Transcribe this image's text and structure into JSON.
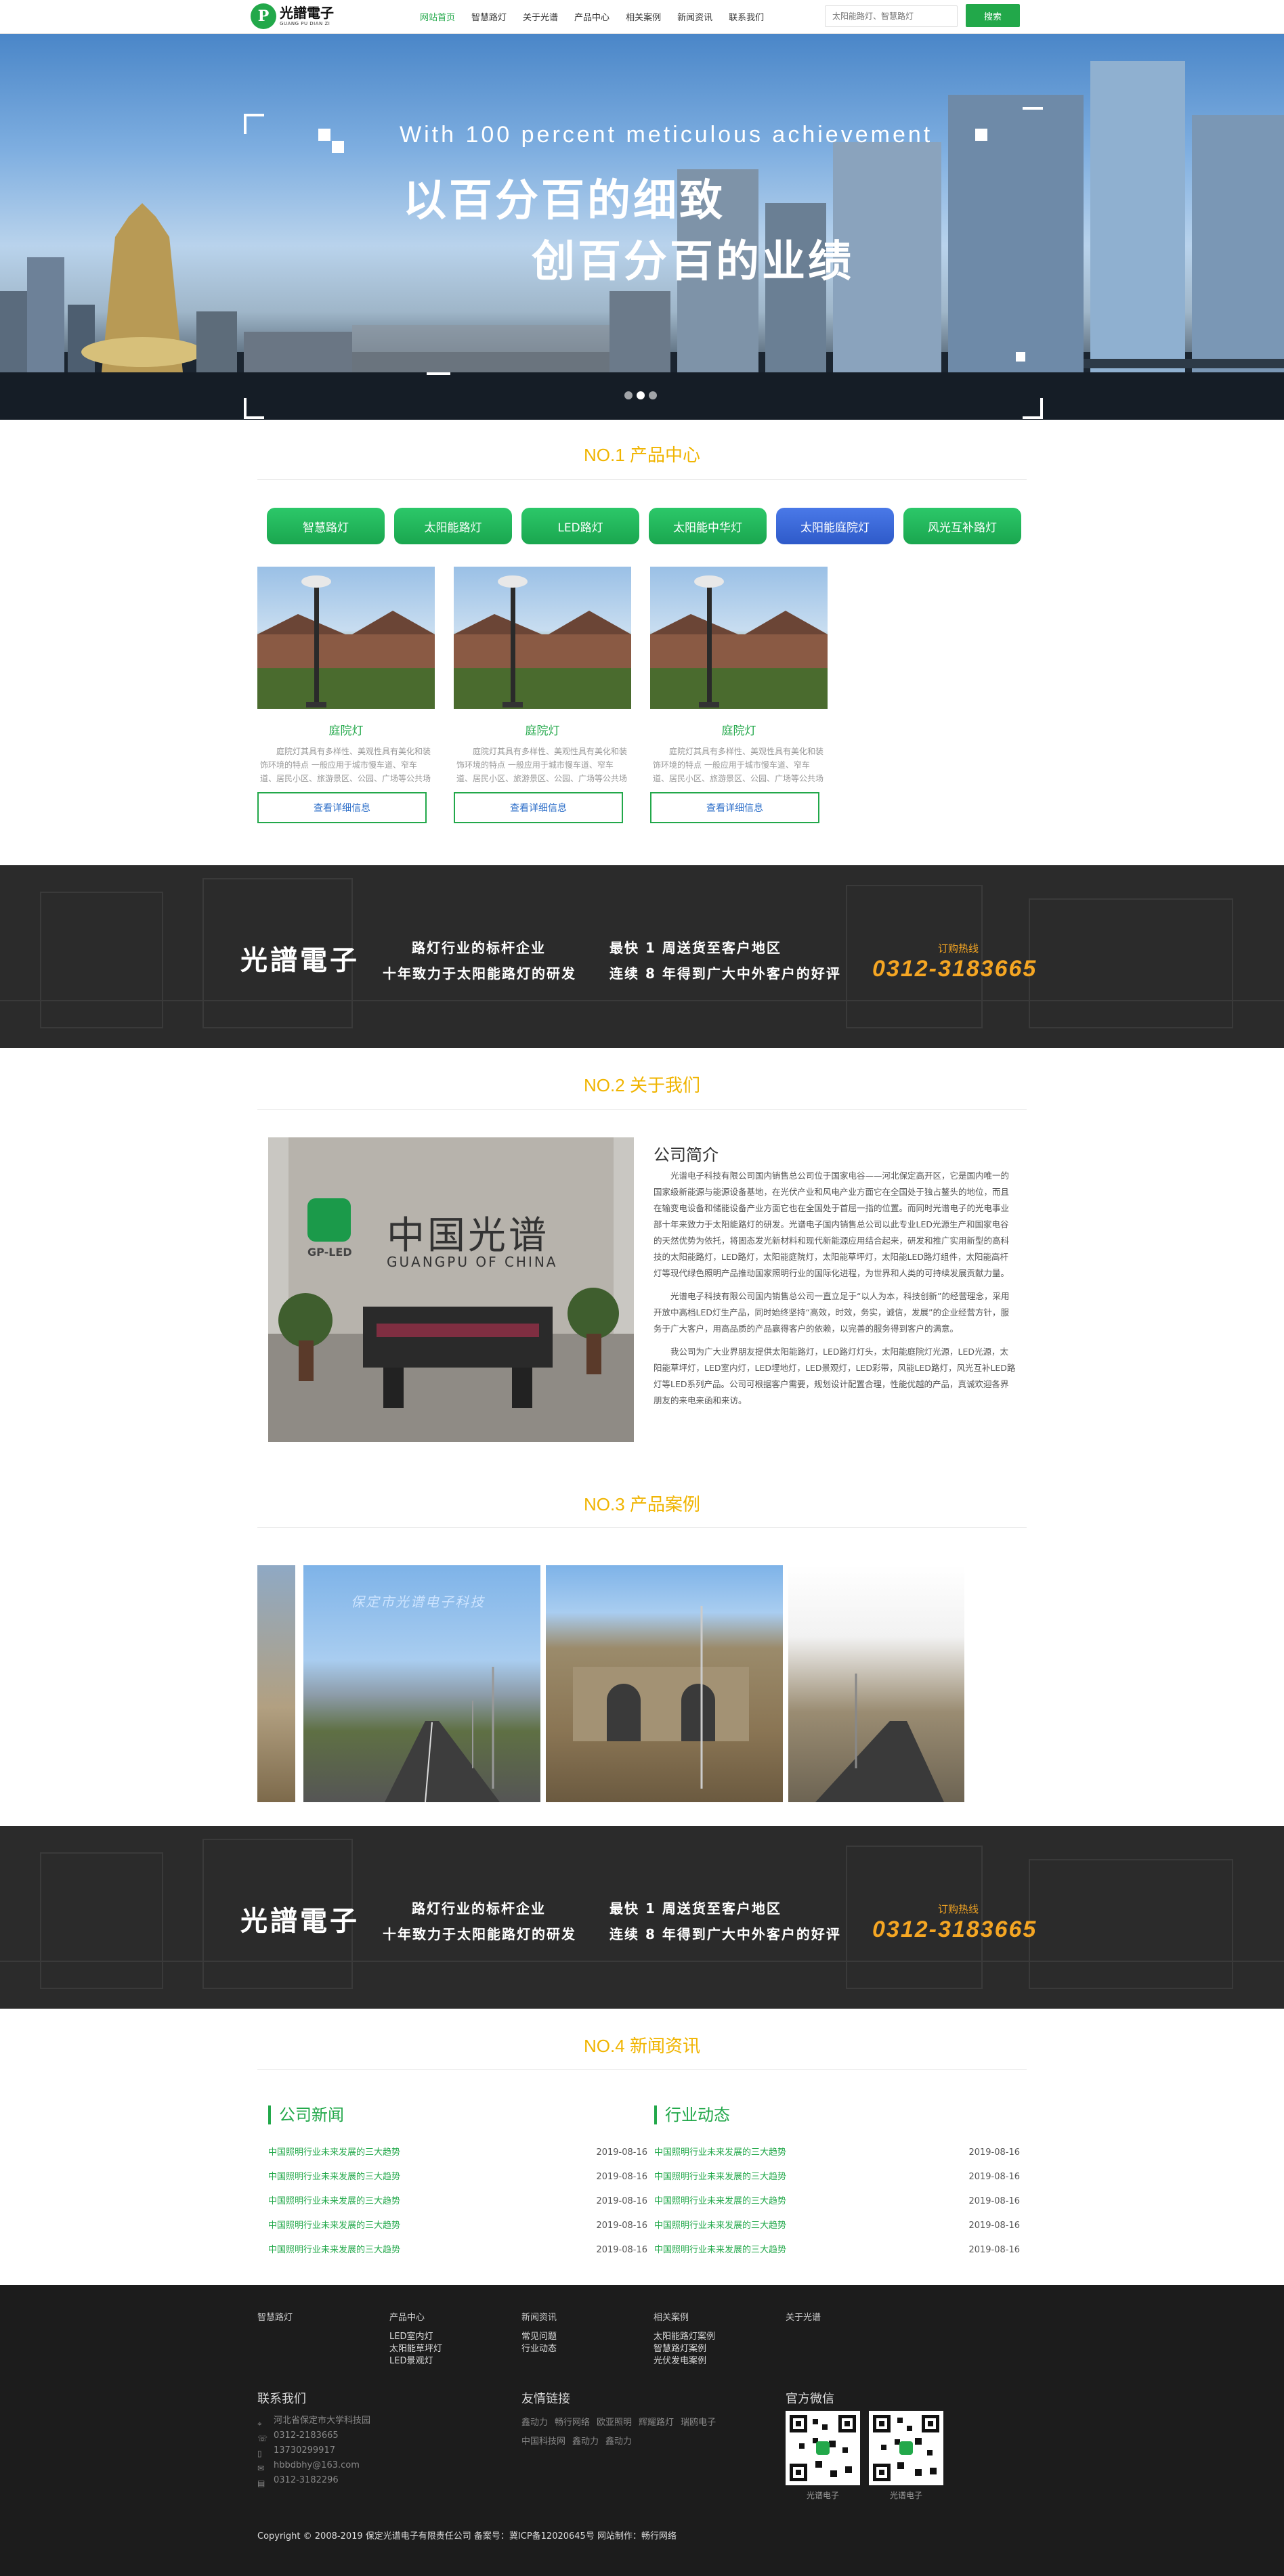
{
  "header": {
    "logo_cn": "光譜電子",
    "logo_en": "GUANG PU DIAN ZI",
    "nav": [
      "网站首页",
      "智慧路灯",
      "关于光谱",
      "产品中心",
      "相关案例",
      "新闻资讯",
      "联系我们"
    ],
    "search_placeholder": "太阳能路灯、智慧路灯",
    "search_button": "搜索"
  },
  "banner": {
    "en": "With 100 percent meticulous achievement",
    "cn_line1": "以百分百的细致",
    "cn_line2": "创百分百的业绩",
    "slides": 3,
    "active_slide": 1
  },
  "products": {
    "title": "NO.1 产品中心",
    "tabs": [
      "智慧路灯",
      "太阳能路灯",
      "LED路灯",
      "太阳能中华灯",
      "太阳能庭院灯",
      "风光互补路灯"
    ],
    "active_tab": 4,
    "items": [
      {
        "name": "庭院灯",
        "desc": "庭院灯其具有多样性、美观性具有美化和装饰环境的特点 一般应用于城市慢车道、窄车道、居民小区、旅游景区、公园、广场等公共场所的室外照明",
        "button": "查看详细信息"
      },
      {
        "name": "庭院灯",
        "desc": "庭院灯其具有多样性、美观性具有美化和装饰环境的特点 一般应用于城市慢车道、窄车道、居民小区、旅游景区、公园、广场等公共场所的室外照明",
        "button": "查看详细信息"
      },
      {
        "name": "庭院灯",
        "desc": "庭院灯其具有多样性、美观性具有美化和装饰环境的特点 一般应用于城市慢车道、窄车道、居民小区、旅游景区、公园、广场等公共场所的室外照明",
        "button": "查看详细信息"
      }
    ]
  },
  "band": {
    "logo": "光譜電子",
    "l1": "路灯行业的标杆企业",
    "l2": "十年致力于太阳能路灯的研发",
    "r1": "最快 1 周送货至客户地区",
    "r2": "连续 8 年得到广大中外客户的好评",
    "hotline_label": "订购热线",
    "phone": "0312-3183665"
  },
  "about": {
    "title": "NO.2 关于我们",
    "sub": "公司简介",
    "wall_cn": "中国光谱",
    "wall_en": "GUANGPU OF CHINA",
    "wall_logo": "GP-LED",
    "paragraphs": [
      "光谱电子科技有限公司国内销售总公司位于国家电谷——河北保定高开区，它是国内唯一的国家级新能源与能源设备基地，在光伏产业和风电产业方面它在全国处于独占鳌头的地位，而且在输变电设备和储能设备产业方面它也在全国处于首屈一指的位置。而同时光谱电子的光电事业部十年来致力于太阳能路灯的研发。光谱电子国内销售总公司以此专业LED光源生产和国家电谷的天然优势为依托，将固态发光新材料和现代新能源应用结合起来，研发和推广实用新型的高科技的太阳能路灯，LED路灯，太阳能庭院灯，太阳能草坪灯，太阳能LED路灯组件，太阳能高杆灯等现代绿色照明产品推动国家照明行业的国际化进程，为世界和人类的可持续发展贡献力量。",
      "光谱电子科技有限公司国内销售总公司一直立足于“以人为本，科技创新”的经营理念，采用开放中高档LED灯生产品，同时始终坚持“高效，时效，务实，诚信，发展”的企业经营方针，服务于广大客户，用高品质的产品赢得客户的依赖，以完善的服务得到客户的满意。",
      "我公司为广大业界朋友提供太阳能路灯，LED路灯灯头，太阳能庭院灯光源，LED光源，太阳能草坪灯，LED室内灯，LED埋地灯，LED景观灯，LED彩带，风能LED路灯，风光互补LED路灯等LED系列产品。公司可根据客户需要，规划设计配置合理，性能优越的产品，真诚欢迎各界朋友的来电来函和来访。"
    ]
  },
  "cases": {
    "title": "NO.3 产品案例",
    "watermark": "保定市光谱电子科技"
  },
  "news": {
    "title": "NO.4 新闻资讯",
    "company": {
      "heading": "公司新闻",
      "items": [
        {
          "t": "中国照明行业未来发展的三大趋势",
          "d": "2019-08-16"
        },
        {
          "t": "中国照明行业未来发展的三大趋势",
          "d": "2019-08-16"
        },
        {
          "t": "中国照明行业未来发展的三大趋势",
          "d": "2019-08-16"
        },
        {
          "t": "中国照明行业未来发展的三大趋势",
          "d": "2019-08-16"
        },
        {
          "t": "中国照明行业未来发展的三大趋势",
          "d": "2019-08-16"
        }
      ]
    },
    "industry": {
      "heading": "行业动态",
      "items": [
        {
          "t": "中国照明行业未来发展的三大趋势",
          "d": "2019-08-16"
        },
        {
          "t": "中国照明行业未来发展的三大趋势",
          "d": "2019-08-16"
        },
        {
          "t": "中国照明行业未来发展的三大趋势",
          "d": "2019-08-16"
        },
        {
          "t": "中国照明行业未来发展的三大趋势",
          "d": "2019-08-16"
        },
        {
          "t": "中国照明行业未来发展的三大趋势",
          "d": "2019-08-16"
        }
      ]
    }
  },
  "footer": {
    "cols": [
      {
        "h": "智慧路灯",
        "items": []
      },
      {
        "h": "产品中心",
        "items": [
          "LED室内灯",
          "太阳能草坪灯",
          "LED景观灯"
        ]
      },
      {
        "h": "新闻资讯",
        "items": [
          "常见问题",
          "行业动态"
        ]
      },
      {
        "h": "相关案例",
        "items": [
          "太阳能路灯案例",
          "智慧路灯案例",
          "光伏发电案例"
        ]
      },
      {
        "h": "关于光谱",
        "items": []
      }
    ],
    "contact_title": "联系我们",
    "contact": [
      "河北省保定市大学科技园",
      "0312-2183665",
      "13730299917",
      "hbbdbhy@163.com",
      "0312-3182296"
    ],
    "links_title": "友情链接",
    "links": [
      "鑫动力",
      "畅行网络",
      "欧亚照明",
      "辉耀路灯",
      "瑞鸥电子",
      "中国科技网",
      "鑫动力",
      "鑫动力"
    ],
    "wechat_title": "官方微信",
    "qr_captions": [
      "光谱电子",
      "光谱电子"
    ],
    "copyright": "Copyright © 2008-2019 保定光谱电子有限责任公司   备案号：冀ICP备12020645号   网站制作：畅行网络"
  }
}
